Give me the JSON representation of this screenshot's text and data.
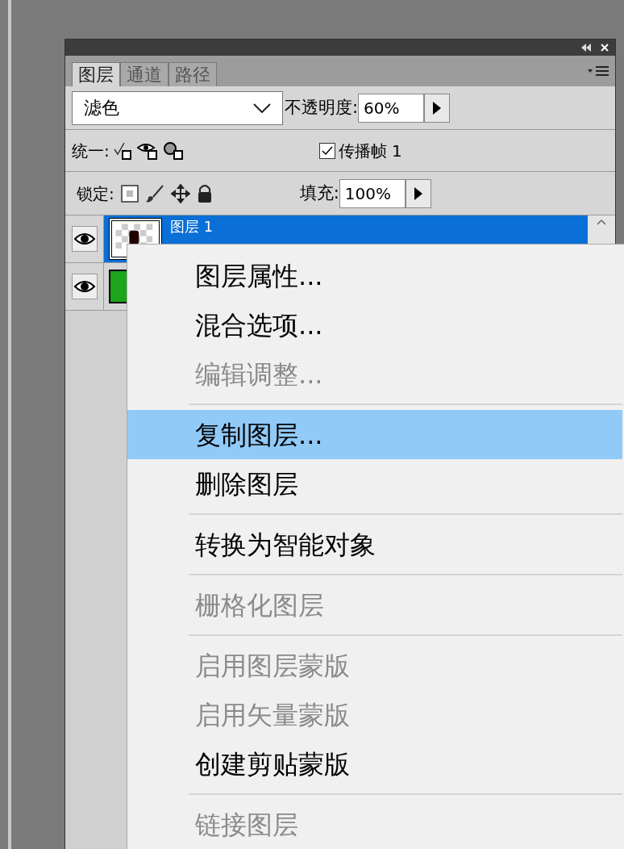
{
  "tabs": [
    {
      "label": "图层",
      "selected": true
    },
    {
      "label": "通道",
      "selected": false
    },
    {
      "label": "路径",
      "selected": false
    }
  ],
  "blend_mode": {
    "value": "滤色"
  },
  "opacity": {
    "label": "不透明度:",
    "value": "60%"
  },
  "unify": {
    "label": "统一:"
  },
  "propagate": {
    "label": "传播帧 1",
    "checked": true
  },
  "lock": {
    "label": "锁定:"
  },
  "fill": {
    "label": "填充:",
    "value": "100%"
  },
  "layers": [
    {
      "kind": "transparent",
      "name": "图层 1",
      "visible": true,
      "selected": true
    },
    {
      "kind": "fill",
      "visible": true,
      "selected": false
    }
  ],
  "context_menu": [
    {
      "kind": "item",
      "label": "图层属性...",
      "disabled": false,
      "selected": false
    },
    {
      "kind": "item",
      "label": "混合选项...",
      "disabled": false,
      "selected": false
    },
    {
      "kind": "item",
      "label": "编辑调整...",
      "disabled": true,
      "selected": false
    },
    {
      "kind": "separator"
    },
    {
      "kind": "item",
      "label": "复制图层...",
      "disabled": false,
      "selected": true
    },
    {
      "kind": "item",
      "label": "删除图层",
      "disabled": false,
      "selected": false
    },
    {
      "kind": "separator"
    },
    {
      "kind": "item",
      "label": "转换为智能对象",
      "disabled": false,
      "selected": false
    },
    {
      "kind": "separator"
    },
    {
      "kind": "item",
      "label": "栅格化图层",
      "disabled": true,
      "selected": false
    },
    {
      "kind": "separator"
    },
    {
      "kind": "item",
      "label": "启用图层蒙版",
      "disabled": true,
      "selected": false
    },
    {
      "kind": "item",
      "label": "启用矢量蒙版",
      "disabled": true,
      "selected": false
    },
    {
      "kind": "item",
      "label": "创建剪贴蒙版",
      "disabled": false,
      "selected": false
    },
    {
      "kind": "separator"
    },
    {
      "kind": "item",
      "label": "链接图层",
      "disabled": true,
      "selected": false
    }
  ]
}
